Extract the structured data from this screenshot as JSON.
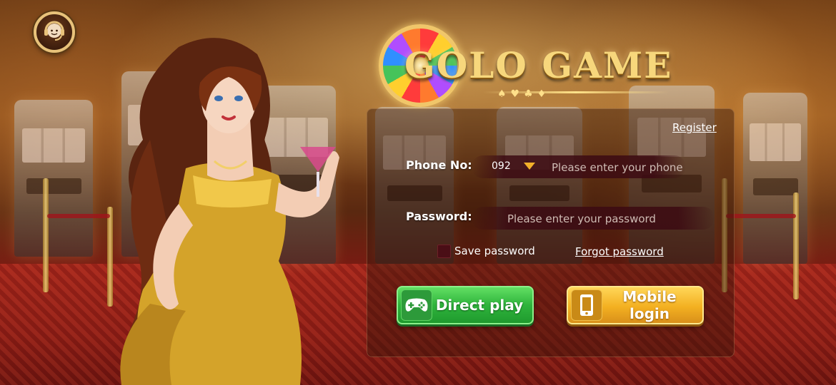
{
  "game": {
    "logo_text": "GOLO GAME"
  },
  "support": {
    "icon": "customer-service-headset-icon"
  },
  "login_panel": {
    "register_label": "Register",
    "phone": {
      "label": "Phone No:",
      "country_code": "092",
      "placeholder": "Please enter your phone",
      "value": ""
    },
    "password": {
      "label": "Password:",
      "placeholder": "Please enter your password",
      "value": ""
    },
    "save_password_label": "Save password",
    "save_password_checked": false,
    "forgot_password_label": "Forgot password"
  },
  "buttons": {
    "direct_play": {
      "label": "Direct play",
      "icon": "gamepad-icon",
      "color": "#2fb43c"
    },
    "mobile_login": {
      "label": "Mobile login",
      "icon": "mobile-phone-icon",
      "color": "#f3b021"
    }
  },
  "colors": {
    "accent_gold": "#f7d77c",
    "panel_field": "#4a0e16",
    "dropdown_arrow": "#f3b12a"
  }
}
